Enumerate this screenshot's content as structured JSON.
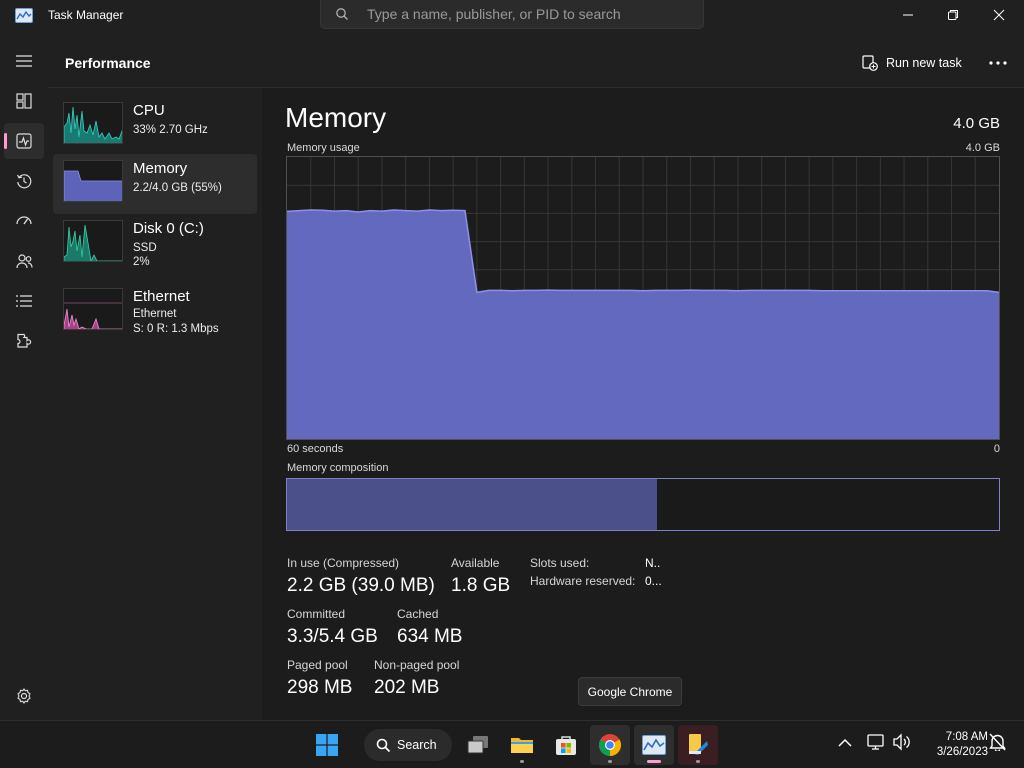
{
  "window": {
    "title": "Task Manager",
    "search_placeholder": "Type a name, publisher, or PID to search",
    "app_icon": "task-manager-icon"
  },
  "nav": {
    "items": [
      "hamburger-icon",
      "processes-icon",
      "performance-icon",
      "app-history-icon",
      "startup-apps-icon",
      "users-icon",
      "details-icon",
      "services-icon",
      "settings-icon"
    ],
    "active": "performance-icon"
  },
  "header": {
    "page_title": "Performance",
    "run_new_task": "Run new task"
  },
  "resources": [
    {
      "name": "CPU",
      "line1": "33%  2.70 GHz",
      "line2": "",
      "color": "#2ec4b6"
    },
    {
      "name": "Memory",
      "line1": "2.2/4.0 GB (55%)",
      "line2": "",
      "color": "#7077d6"
    },
    {
      "name": "Disk 0 (C:)",
      "line1": "SSD",
      "line2": "2%",
      "color": "#2ec4a0"
    },
    {
      "name": "Ethernet",
      "line1": "Ethernet",
      "line2": "S: 0  R: 1.3 Mbps",
      "color": "#e080c0"
    }
  ],
  "memory": {
    "title": "Memory",
    "total": "4.0 GB",
    "usage_label": "Memory usage",
    "usage_max": "4.0 GB",
    "time_left": "60 seconds",
    "time_right": "0",
    "composition_label": "Memory composition",
    "composition_in_use_fraction": 0.52,
    "usage_history_fraction": [
      0.807,
      0.81,
      0.812,
      0.811,
      0.808,
      0.81,
      0.805,
      0.81,
      0.808,
      0.812,
      0.81,
      0.808,
      0.812,
      0.81,
      0.811,
      0.81,
      0.52,
      0.527,
      0.527,
      0.526,
      0.527,
      0.527,
      0.528,
      0.527,
      0.527,
      0.527,
      0.527,
      0.527,
      0.527,
      0.527,
      0.526,
      0.527,
      0.527,
      0.527,
      0.528,
      0.527,
      0.527,
      0.527,
      0.526,
      0.527,
      0.527,
      0.527,
      0.527,
      0.527,
      0.527,
      0.526,
      0.526,
      0.526,
      0.526,
      0.526,
      0.526,
      0.526,
      0.526,
      0.526,
      0.526,
      0.526,
      0.526,
      0.526,
      0.526,
      0.526,
      0.52
    ],
    "stats": {
      "in_use_label": "In use (Compressed)",
      "in_use_value": "2.2 GB (39.0 MB)",
      "available_label": "Available",
      "available_value": "1.8 GB",
      "committed_label": "Committed",
      "committed_value": "3.3/5.4 GB",
      "cached_label": "Cached",
      "cached_value": "634 MB",
      "paged_label": "Paged pool",
      "paged_value": "298 MB",
      "nonpaged_label": "Non-paged pool",
      "nonpaged_value": "202 MB",
      "slots_label": "Slots used:",
      "slots_value": "N..",
      "hw_label": "Hardware reserved:",
      "hw_value": "0..."
    }
  },
  "tooltip": "Google Chrome",
  "taskbar": {
    "search_label": "Search",
    "apps": [
      "start-icon",
      "search-icon",
      "task-view-icon",
      "file-explorer-icon",
      "microsoft-store-icon",
      "chrome-icon",
      "task-manager-icon",
      "paint-icon"
    ],
    "time": "7:08 AM",
    "date": "3/26/2023"
  },
  "colors": {
    "accent": "#ff9bd3",
    "memory_fill": "#6469c0",
    "memory_line": "#8c92e6"
  }
}
